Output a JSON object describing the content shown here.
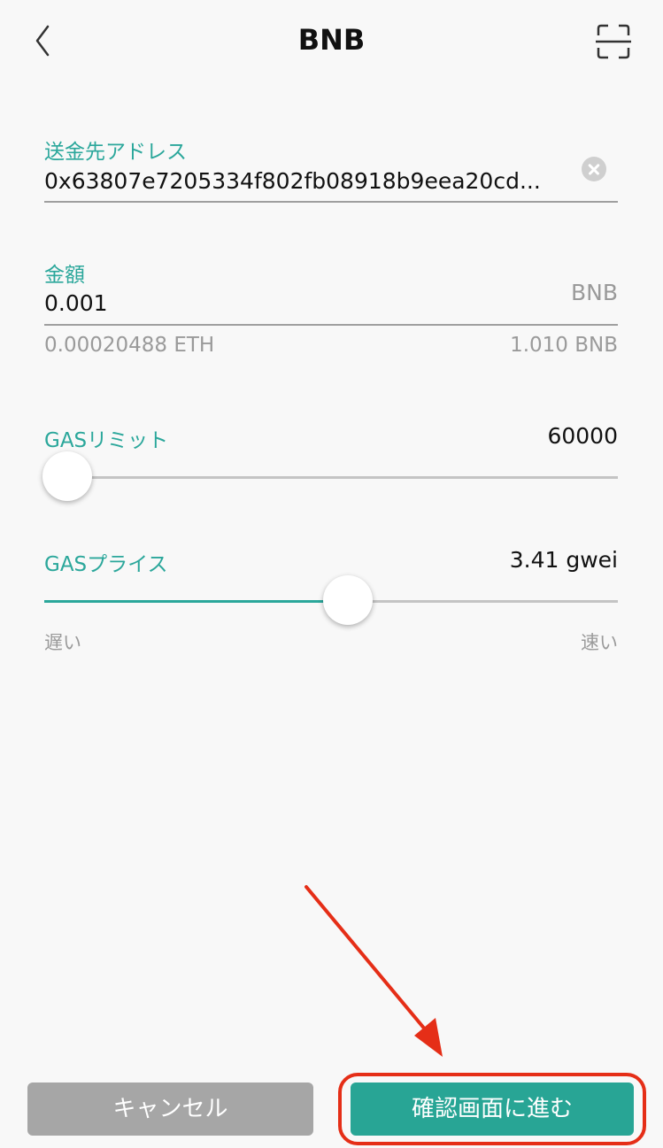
{
  "header": {
    "title": "BNB",
    "back_icon": "chevron-left-icon",
    "scan_icon": "scan-icon"
  },
  "address": {
    "label": "送金先アドレス",
    "value": "0x63807e7205334f802fb08918b9eea20cd..."
  },
  "amount": {
    "label": "金額",
    "value": "0.001",
    "unit": "BNB",
    "eth_equivalent": "0.00020488 ETH",
    "balance": "1.010 BNB"
  },
  "gas_limit": {
    "label": "GASリミット",
    "value": "60000",
    "slider_fraction": 0.0
  },
  "gas_price": {
    "label": "GASプライス",
    "value": "3.41 gwei",
    "slider_fraction": 0.53,
    "min_label": "遅い",
    "max_label": "速い"
  },
  "footer": {
    "cancel_label": "キャンセル",
    "confirm_label": "確認画面に進む"
  },
  "colors": {
    "accent": "#2ba79b",
    "confirm_button": "#28a595",
    "cancel_button": "#a6a6a6",
    "annotation": "#e52e17"
  }
}
